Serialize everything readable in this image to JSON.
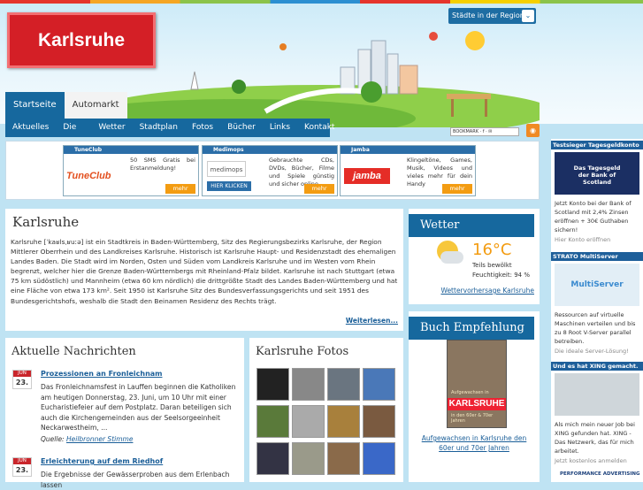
{
  "header": {
    "logo": "Karlsruhe",
    "regions_label": "Städte in der Region",
    "social_label": "BOOKMARK · f · ✉"
  },
  "nav_primary": [
    {
      "label": "Startseite",
      "active": true
    },
    {
      "label": "Automarkt",
      "active": false
    }
  ],
  "nav_secondary": [
    "Aktuelles",
    "Die Stadt",
    "Wetter",
    "Stadtplan",
    "Fotos",
    "Bücher",
    "Links",
    "Kontakt"
  ],
  "ads": [
    {
      "name": "TuneClub",
      "logo": "TuneClub",
      "text": "50 SMS Gratis bei Erstanmeldung!",
      "mehr": "mehr"
    },
    {
      "name": "Medimops",
      "logo": "medimops",
      "button": "HIER KLICKEN",
      "text": "Gebrauchte CDs, DVDs, Bücher, Filme und Spiele günstig und sicher online",
      "mehr": "mehr"
    },
    {
      "name": "Jamba",
      "logo": "jamba",
      "text": "Klingeltöne, Games, Musik, Videos und vieles mehr für dein Handy",
      "mehr": "mehr"
    }
  ],
  "intro": {
    "title": "Karlsruhe",
    "text": "Karlsruhe [ˈkaʁlsˌʁuːə] ist ein Stadtkreis in Baden-Württemberg, Sitz des Regierungsbezirks Karlsruhe, der Region Mittlerer Oberrhein und des Landkreises Karlsruhe. Historisch ist Karlsruhe Haupt- und Residenzstadt des ehemaligen Landes Baden. Die Stadt wird im Norden, Osten und Süden vom Landkreis Karlsruhe und im Westen vom Rhein begrenzt, welcher hier die Grenze Baden-Württembergs mit Rheinland-Pfalz bildet. Karlsruhe ist nach Stuttgart (etwa 75 km südöstlich) und Mannheim (etwa 60 km nördlich) die drittgrößte Stadt des Landes Baden-Württemberg und hat eine Fläche von etwa 173 km². Seit 1950 ist Karlsruhe Sitz des Bundesverfassungsgerichts und seit 1951 des Bundesgerichtshofs, weshalb die Stadt den Beinamen Residenz des Rechts trägt.",
    "more": "Weiterlesen..."
  },
  "weather": {
    "title": "Wetter",
    "temp": "16°C",
    "cond": "Teils bewölkt",
    "humidity": "Feuchtigkeit: 94 %",
    "link": "Wettervorhersage Karlsruhe"
  },
  "book": {
    "title": "Buch Empfehlung",
    "cover_top": "Aufgewachsen in",
    "cover_title": "KARLSRUHE",
    "cover_sub": "in den 60er & 70er Jahren",
    "caption": "Aufgewachsen in Karlsruhe den 60er und 70er Jahren"
  },
  "news": {
    "title": "Aktuelle Nachrichten",
    "items": [
      {
        "month": "JUN",
        "day": "23.",
        "title": "Prozessionen an Fronleichnam",
        "body": "Das Fronleichnamsfest in Lauffen beginnen die Katholiken am heutigen Donnerstag, 23. Juni, um 10 Uhr mit einer Eucharistiefeier auf dem Postplatz. Daran beteiligen sich auch die Kirchengemeinden aus der Seelsorgeeinheit Neckarwestheim, ...",
        "source_label": "Quelle:",
        "source": "Heilbronner Stimme"
      },
      {
        "month": "JUN",
        "day": "23.",
        "title": "Erleichterung auf dem Riedhof",
        "body": "Die Ergebnisse der Gewässerproben aus dem Erlenbach lassen"
      }
    ]
  },
  "photos": {
    "title": "Karlsruhe Fotos"
  },
  "right_ads": [
    {
      "head": "Testsieger Tagesgeldkonto",
      "img": "Das Tagesgeld der Bank of Scotland",
      "text": "Jetzt Konto bei der Bank of Scotland mit 2,4% Zinsen eröffnen + 30€ Guthaben sichern!",
      "sub": "Hier Konto eröffnen"
    },
    {
      "head": "STRATO MultiServer",
      "img": "MultiServer",
      "text": "Ressourcen auf virtuelle Maschinen verteilen und bis zu 8 Root V-Server parallel betreiben.",
      "sub": "Die ideale Server-Lösung!"
    },
    {
      "head": "Und es hat XING gemacht.",
      "text": "Als mich mein neuer Job bei XING gefunden hat. XING - Das Netzwerk, das für mich arbeitet.",
      "sub": "Jetzt kostenlos anmelden"
    }
  ],
  "footer_ad": "PERFORMANCE ADVERTISING"
}
